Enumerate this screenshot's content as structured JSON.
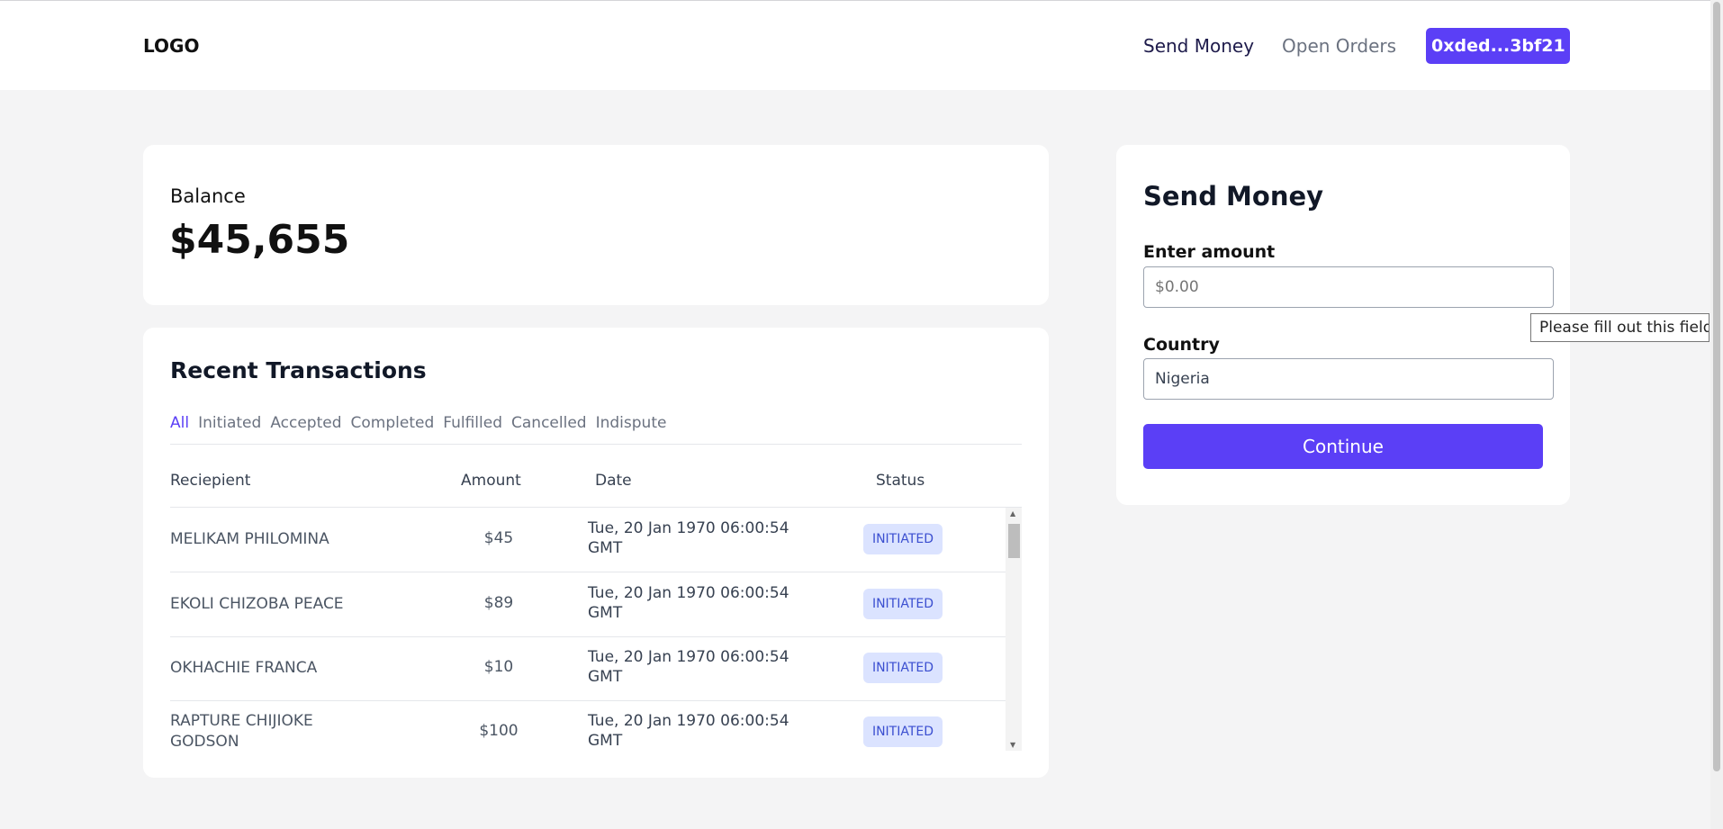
{
  "navbar": {
    "logo": "LOGO",
    "links": {
      "send_money": "Send Money",
      "open_orders": "Open Orders"
    },
    "wallet": "0xded...3bf21"
  },
  "balance": {
    "label": "Balance",
    "value": "$45,655"
  },
  "transactions": {
    "title": "Recent Transactions",
    "filters": [
      "All",
      "Initiated",
      "Accepted",
      "Completed",
      "Fulfilled",
      "Cancelled",
      "Indispute"
    ],
    "active_filter": "All",
    "columns": {
      "recipient": "Reciepient",
      "amount": "Amount",
      "date": "Date",
      "status": "Status"
    },
    "rows": [
      {
        "recipient": "MELIKAM PHILOMINA",
        "amount": "$45",
        "date": "Tue, 20 Jan 1970 06:00:54 GMT",
        "status": "INITIATED"
      },
      {
        "recipient": "EKOLI CHIZOBA PEACE",
        "amount": "$89",
        "date": "Tue, 20 Jan 1970 06:00:54 GMT",
        "status": "INITIATED"
      },
      {
        "recipient": "OKHACHIE FRANCA",
        "amount": "$10",
        "date": "Tue, 20 Jan 1970 06:00:54 GMT",
        "status": "INITIATED"
      },
      {
        "recipient": "RAPTURE CHIJIOKE GODSON",
        "amount": "$100",
        "date": "Tue, 20 Jan 1970 06:00:54 GMT",
        "status": "INITIATED"
      }
    ]
  },
  "send_money": {
    "title": "Send Money",
    "amount_label": "Enter amount",
    "amount_placeholder": "$0.00",
    "amount_value": "",
    "country_label": "Country",
    "country_value": "Nigeria",
    "continue_label": "Continue",
    "validation_tooltip": "Please fill out this field."
  },
  "colors": {
    "accent": "#5b3ff6",
    "badge_bg": "#dbe3ff",
    "badge_text": "#3b4fd0",
    "page_bg": "#f4f4f5"
  }
}
